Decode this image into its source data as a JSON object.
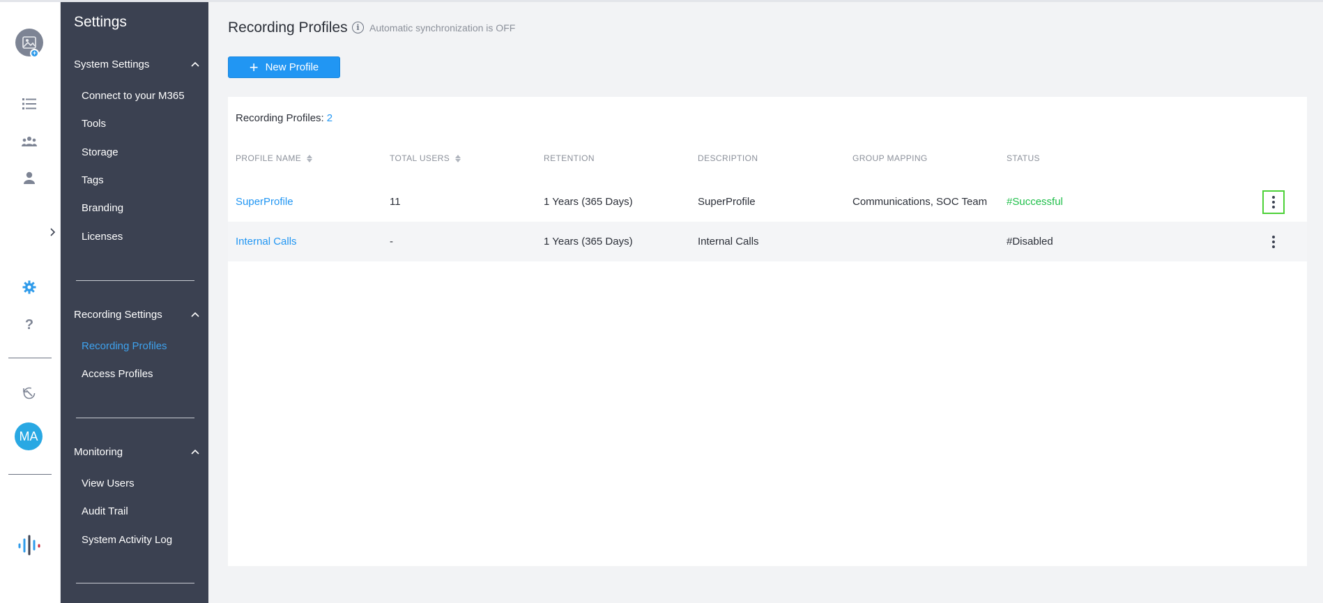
{
  "sidebar": {
    "title": "Settings",
    "sections": [
      {
        "label": "System Settings",
        "items": [
          "Connect to your M365",
          "Tools",
          "Storage",
          "Tags",
          "Branding",
          "Licenses"
        ]
      },
      {
        "label": "Recording Settings",
        "items": [
          "Recording Profiles",
          "Access Profiles"
        ]
      },
      {
        "label": "Monitoring",
        "items": [
          "View Users",
          "Audit Trail",
          "System Activity Log"
        ]
      }
    ],
    "active_item": "Recording Profiles"
  },
  "rail": {
    "user_initials": "MA",
    "accent_color": "#2f9bea"
  },
  "main": {
    "title": "Recording Profiles",
    "sync_status": "Automatic synchronization is OFF",
    "new_button_label": "New Profile",
    "count_label": "Recording Profiles:",
    "count_value": "2",
    "columns": [
      "PROFILE NAME",
      "TOTAL USERS",
      "RETENTION",
      "DESCRIPTION",
      "GROUP MAPPING",
      "STATUS"
    ],
    "rows": [
      {
        "name": "SuperProfile",
        "total_users": "11",
        "retention": "1 Years (365 Days)",
        "description": "SuperProfile",
        "group_mapping": "Communications, SOC Team",
        "status": "#Successful"
      },
      {
        "name": "Internal Calls",
        "total_users": "-",
        "retention": "1 Years (365 Days)",
        "description": "Internal Calls",
        "group_mapping": "",
        "status": "#Disabled"
      }
    ]
  },
  "colors": {
    "primary": "#2196f3",
    "sidebar_bg": "#3b4151",
    "success": "#1fbf4a",
    "focus_outline": "#4cd137"
  }
}
